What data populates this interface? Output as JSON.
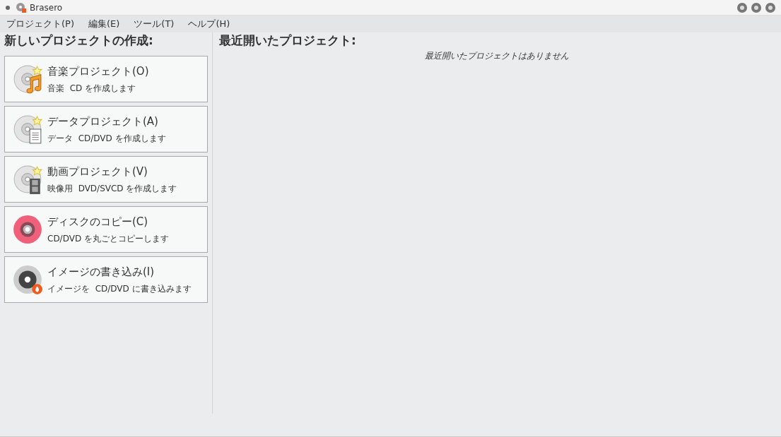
{
  "window": {
    "title": "Brasero"
  },
  "menu": [
    "プロジェクト(P)",
    "編集(E)",
    "ツール(T)",
    "ヘルプ(H)"
  ],
  "new_project": {
    "heading": "新しいプロジェクトの作成:",
    "items": [
      {
        "kind": "music",
        "title": "音楽プロジェクト(O)",
        "description": "音楽  CD を作成します"
      },
      {
        "kind": "data",
        "title": "データプロジェクト(A)",
        "description": "データ  CD/DVD を作成します"
      },
      {
        "kind": "video",
        "title": "動画プロジェクト(V)",
        "description": "映像用  DVD/SVCD を作成します"
      },
      {
        "kind": "copy",
        "title": "ディスクのコピー(C)",
        "description": "CD/DVD を丸ごとコピーします"
      },
      {
        "kind": "burn",
        "title": "イメージの書き込み(I)",
        "description": "イメージを  CD/DVD に書き込みます"
      }
    ]
  },
  "recent": {
    "heading": "最近開いたプロジェクト:",
    "empty_message": "最近開いたプロジェクトはありません"
  }
}
